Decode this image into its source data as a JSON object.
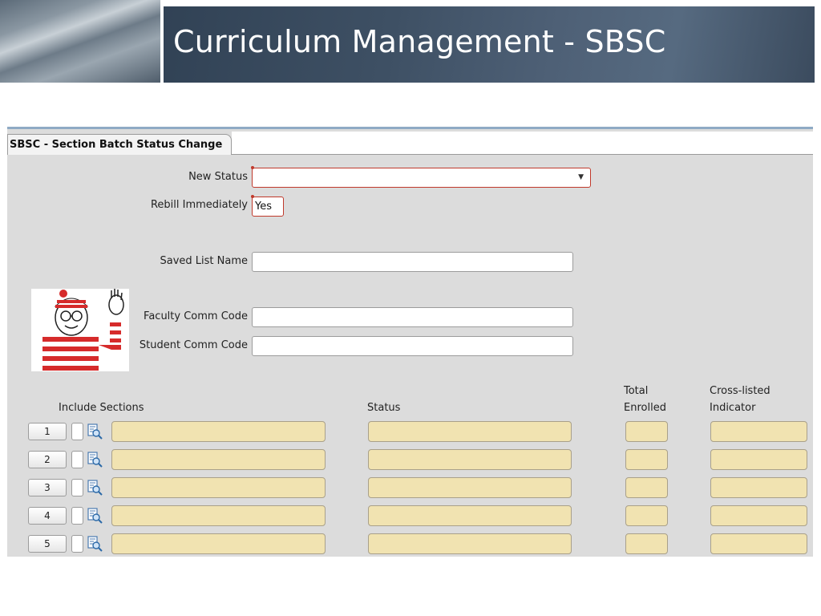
{
  "slide": {
    "title": "Curriculum Management - SBSC"
  },
  "form": {
    "tab_label": "SBSC - Section Batch Status Change",
    "fields": {
      "new_status": {
        "label": "New Status",
        "value": ""
      },
      "rebill_immediately": {
        "label": "Rebill Immediately",
        "value": "Yes"
      },
      "saved_list_name": {
        "label": "Saved List Name",
        "value": ""
      },
      "faculty_comm_code": {
        "label": "Faculty Comm Code",
        "value": ""
      },
      "student_comm_code": {
        "label": "Student Comm Code",
        "value": ""
      }
    },
    "table": {
      "headers": {
        "include_sections": "Include Sections",
        "status": "Status",
        "total_enrolled_1": "Total",
        "total_enrolled_2": "Enrolled",
        "cross_listed_1": "Cross-listed",
        "cross_listed_2": "Indicator"
      },
      "rows": [
        {
          "num": "1"
        },
        {
          "num": "2"
        },
        {
          "num": "3"
        },
        {
          "num": "4"
        },
        {
          "num": "5"
        }
      ]
    }
  },
  "colors": {
    "required_border": "#c0392b",
    "readonly_cell": "#f1e3b1",
    "banner": "#3e5064"
  },
  "icons": {
    "dropdown": "chevron-down-icon",
    "lookup": "lookup-icon",
    "character": "waldo-character-illustration"
  }
}
